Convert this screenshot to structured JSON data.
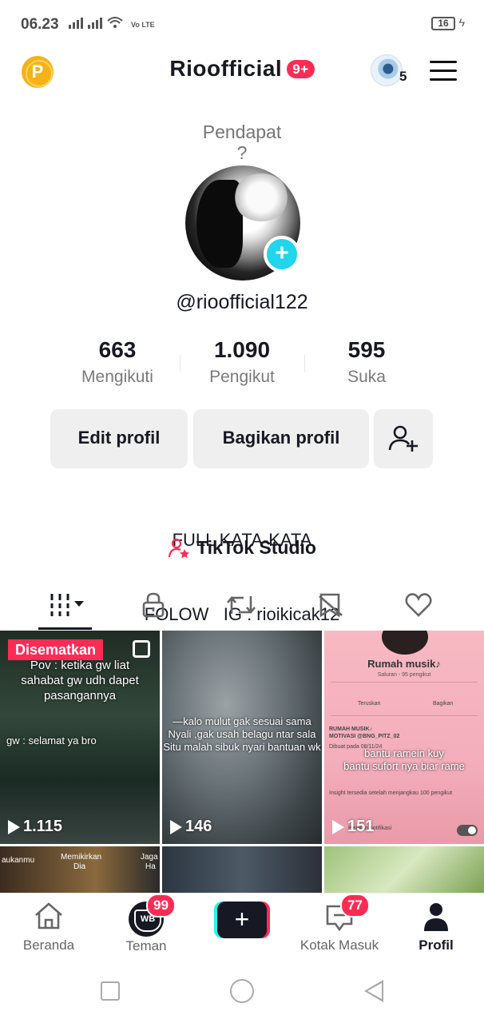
{
  "status_bar": {
    "time": "06.23",
    "network": "Vo LTE",
    "battery": "16"
  },
  "header": {
    "coin_label": "P",
    "profile_name": "Rioofficial",
    "notification_badge": "9+",
    "story_count": "5",
    "icons": {
      "coin": "p-coin-icon",
      "menu": "hamburger-menu-icon"
    }
  },
  "profile": {
    "opinion_line1": "Pendapat",
    "opinion_line2": "?",
    "username": "@rioofficial122",
    "stats": [
      {
        "value": "663",
        "label": "Mengikuti"
      },
      {
        "value": "1.090",
        "label": "Pengikut"
      },
      {
        "value": "595",
        "label": "Suka"
      }
    ],
    "buttons": {
      "edit": "Edit profil",
      "share": "Bagikan profil"
    },
    "bio_line1": "FULL KATA-KATA",
    "bio_line2": "FOLOW   IG : rioikicak12",
    "studio_label": "TikTok Studio"
  },
  "tabs": [
    "videos-grid",
    "private",
    "reposts",
    "favorites",
    "liked"
  ],
  "videos": [
    {
      "pinned_label": "Disematkan",
      "caption_line1": "Pov : ketika gw liat",
      "caption_line2": "sahabat gw udh dapet",
      "caption_line3": "pasangannya",
      "caption_line4": "gw : selamat ya bro",
      "views": "1.115"
    },
    {
      "caption_line1": "—kalo mulut gak sesuai sama",
      "caption_line2": "Nyali ,gak usah belagu ntar sala",
      "caption_line3": "Situ malah sibuk nyari bantuan wk",
      "views": "146"
    },
    {
      "group_title": "Rumah musik♪",
      "group_sub": "Saluran - 95 pengikut",
      "action_left": "Teruskan",
      "action_right": "Bagikan",
      "post_title": "RUMAH MUSIK♪",
      "post_sub": "MOTIVASI @BNG_PITZ_02",
      "created": "Dibuat pada 08/11/24",
      "insight": "Insight tersedia setelah menjangkau 100 pengikut",
      "notif_label": "Bisukan notifikasi",
      "caption_line1": "bantu ramein kuy",
      "caption_line2": "bantu sufort nya biar rame",
      "views": "151"
    },
    {
      "caption_left": "aukanmu",
      "caption_mid1": "Memikirkan",
      "caption_mid2": "Dia",
      "caption_right1": "Jaga",
      "caption_right2": "Ha"
    },
    {},
    {}
  ],
  "bottom_nav": {
    "home": "Beranda",
    "friends": "Teman",
    "friends_badge": "99",
    "inbox": "Kotak Masuk",
    "inbox_badge": "77",
    "profile": "Profil"
  },
  "colors": {
    "accent": "#fe2c55",
    "cyan": "#25f4ee",
    "button_bg": "#efefef",
    "text_primary": "#161823",
    "text_secondary": "#7a7a7a"
  }
}
